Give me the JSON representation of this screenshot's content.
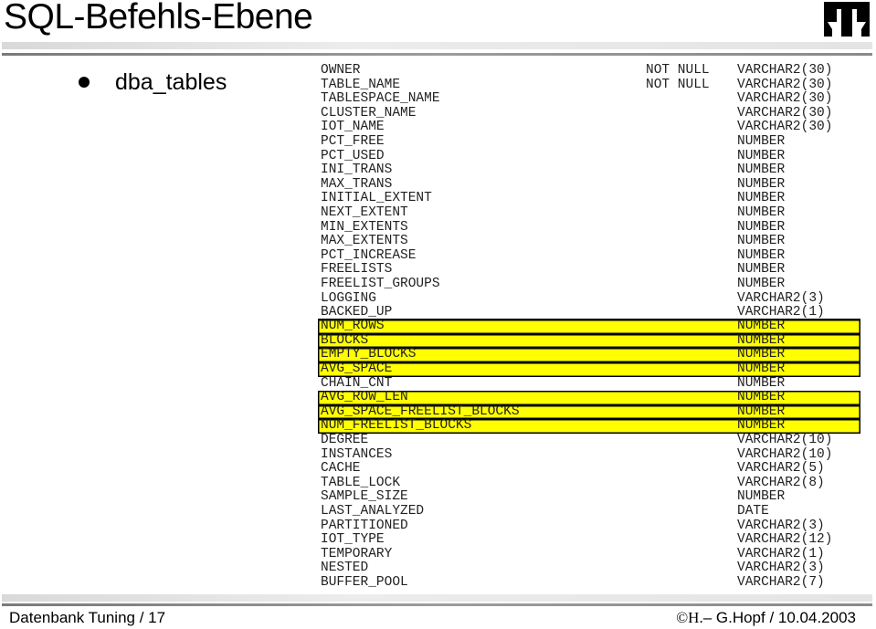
{
  "header": {
    "title": "SQL-Befehls-Ebene",
    "logo_icon": "institution-logo-icon"
  },
  "bullet": {
    "label": "dba_tables"
  },
  "columns": [
    {
      "name": "OWNER",
      "null": "NOT NULL",
      "type": "VARCHAR2(30)",
      "highlight": false
    },
    {
      "name": "TABLE_NAME",
      "null": "NOT NULL",
      "type": "VARCHAR2(30)",
      "highlight": false
    },
    {
      "name": "TABLESPACE_NAME",
      "null": "",
      "type": "VARCHAR2(30)",
      "highlight": false
    },
    {
      "name": "CLUSTER_NAME",
      "null": "",
      "type": "VARCHAR2(30)",
      "highlight": false
    },
    {
      "name": "IOT_NAME",
      "null": "",
      "type": "VARCHAR2(30)",
      "highlight": false
    },
    {
      "name": "PCT_FREE",
      "null": "",
      "type": "NUMBER",
      "highlight": false
    },
    {
      "name": "PCT_USED",
      "null": "",
      "type": "NUMBER",
      "highlight": false
    },
    {
      "name": "INI_TRANS",
      "null": "",
      "type": "NUMBER",
      "highlight": false
    },
    {
      "name": "MAX_TRANS",
      "null": "",
      "type": "NUMBER",
      "highlight": false
    },
    {
      "name": "INITIAL_EXTENT",
      "null": "",
      "type": "NUMBER",
      "highlight": false
    },
    {
      "name": "NEXT_EXTENT",
      "null": "",
      "type": "NUMBER",
      "highlight": false
    },
    {
      "name": "MIN_EXTENTS",
      "null": "",
      "type": "NUMBER",
      "highlight": false
    },
    {
      "name": "MAX_EXTENTS",
      "null": "",
      "type": "NUMBER",
      "highlight": false
    },
    {
      "name": "PCT_INCREASE",
      "null": "",
      "type": "NUMBER",
      "highlight": false
    },
    {
      "name": "FREELISTS",
      "null": "",
      "type": "NUMBER",
      "highlight": false
    },
    {
      "name": "FREELIST_GROUPS",
      "null": "",
      "type": "NUMBER",
      "highlight": false
    },
    {
      "name": "LOGGING",
      "null": "",
      "type": "VARCHAR2(3)",
      "highlight": false
    },
    {
      "name": "BACKED_UP",
      "null": "",
      "type": "VARCHAR2(1)",
      "highlight": false,
      "separator": true
    },
    {
      "name": "NUM_ROWS",
      "null": "",
      "type": "NUMBER",
      "highlight": true
    },
    {
      "name": "BLOCKS",
      "null": "",
      "type": "NUMBER",
      "highlight": true
    },
    {
      "name": "EMPTY_BLOCKS",
      "null": "",
      "type": "NUMBER",
      "highlight": true
    },
    {
      "name": "AVG_SPACE",
      "null": "",
      "type": "NUMBER",
      "highlight": true
    },
    {
      "name": "CHAIN_CNT",
      "null": "",
      "type": "NUMBER",
      "highlight": false
    },
    {
      "name": "AVG_ROW_LEN",
      "null": "",
      "type": "NUMBER",
      "highlight": true
    },
    {
      "name": "AVG_SPACE_FREELIST_BLOCKS",
      "null": "",
      "type": "NUMBER",
      "highlight": true
    },
    {
      "name": "NUM_FREELIST_BLOCKS",
      "null": "",
      "type": "NUMBER",
      "highlight": true
    },
    {
      "name": "DEGREE",
      "null": "",
      "type": "VARCHAR2(10)",
      "highlight": false
    },
    {
      "name": "INSTANCES",
      "null": "",
      "type": "VARCHAR2(10)",
      "highlight": false
    },
    {
      "name": "CACHE",
      "null": "",
      "type": "VARCHAR2(5)",
      "highlight": false
    },
    {
      "name": "TABLE_LOCK",
      "null": "",
      "type": "VARCHAR2(8)",
      "highlight": false
    },
    {
      "name": "SAMPLE_SIZE",
      "null": "",
      "type": "NUMBER",
      "highlight": false
    },
    {
      "name": "LAST_ANALYZED",
      "null": "",
      "type": "DATE",
      "highlight": false
    },
    {
      "name": "PARTITIONED",
      "null": "",
      "type": "VARCHAR2(3)",
      "highlight": false
    },
    {
      "name": "IOT_TYPE",
      "null": "",
      "type": "VARCHAR2(12)",
      "highlight": false
    },
    {
      "name": "TEMPORARY",
      "null": "",
      "type": "VARCHAR2(1)",
      "highlight": false
    },
    {
      "name": "NESTED",
      "null": "",
      "type": "VARCHAR2(3)",
      "highlight": false
    },
    {
      "name": "BUFFER_POOL",
      "null": "",
      "type": "VARCHAR2(7)",
      "highlight": false
    }
  ],
  "colors": {
    "highlight": "#ffff00",
    "text": "#222222"
  },
  "footer": {
    "left": "Datenbank Tuning / 17",
    "copyright_symbol": "©H.",
    "right": "– G.Hopf / 10.04.2003"
  }
}
